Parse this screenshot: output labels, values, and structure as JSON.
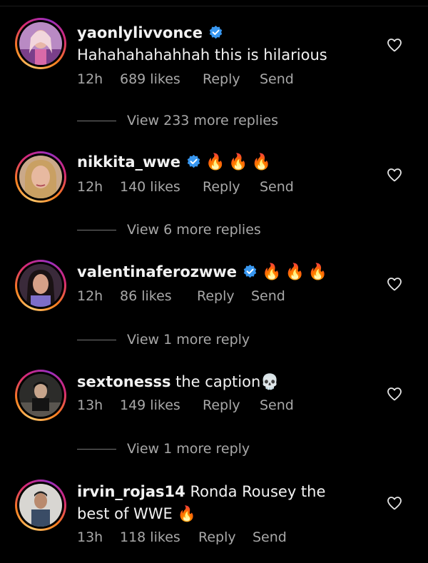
{
  "colors": {
    "background": "#000000",
    "text": "#f2f2f2",
    "muted": "#a8a8a8",
    "verified": "#3897f0"
  },
  "comments": [
    {
      "username": "yaonlylivvonce",
      "verified": true,
      "text": "Hahahahahahhah this is hilarious",
      "time": "12h",
      "likes": "689 likes",
      "reply": "Reply",
      "send": "Send",
      "view_replies": "View 233 more replies"
    },
    {
      "username": "nikkita_wwe",
      "verified": true,
      "text": "🔥🔥🔥",
      "time": "12h",
      "likes": "140 likes",
      "reply": "Reply",
      "send": "Send",
      "view_replies": "View 6 more replies"
    },
    {
      "username": "valentinaferozwwe",
      "verified": true,
      "text": "🔥🔥🔥",
      "time": "12h",
      "likes": "86 likes",
      "reply": "Reply",
      "send": "Send",
      "view_replies": "View 1 more reply"
    },
    {
      "username": "sextonesss",
      "verified": false,
      "text": "the caption💀",
      "time": "13h",
      "likes": "149 likes",
      "reply": "Reply",
      "send": "Send",
      "view_replies": "View 1 more reply"
    },
    {
      "username": "irvin_rojas14",
      "verified": false,
      "text": "Ronda Rousey the best of WWE 🔥",
      "time": "13h",
      "likes": "118 likes",
      "reply": "Reply",
      "send": "Send"
    }
  ]
}
